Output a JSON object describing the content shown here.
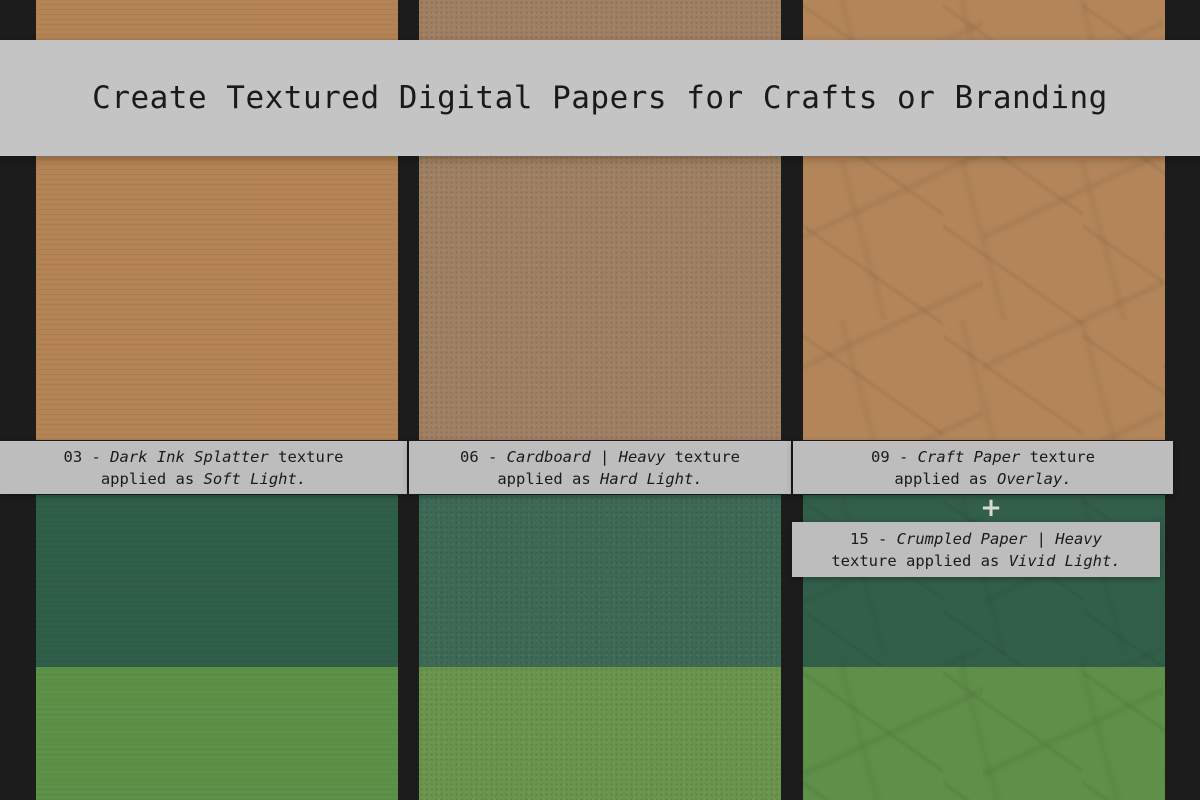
{
  "header": {
    "title": "Create Textured Digital Papers for Crafts or Branding"
  },
  "colors": {
    "background": "#1c1c1c",
    "band": "#c4c4c4",
    "caption_bg": "#bdbdbd",
    "col1_top": "#b48455",
    "col1_mid": "#2f5f48",
    "col1_bot": "#5e9148",
    "col2_top": "#9f8062",
    "col2_mid": "#3d6955",
    "col2_bot": "#6a954c",
    "col3_top": "#b38559",
    "col3_mid": "#325f4a",
    "col3_bot": "#5f8f48"
  },
  "captions": [
    {
      "number": "03 -",
      "name": "Dark Ink Splatter",
      "suffix": "texture",
      "applied": "applied as",
      "mode": "Soft Light."
    },
    {
      "number": "06 -",
      "name": "Cardboard | Heavy",
      "suffix": "texture",
      "applied": "applied as",
      "mode": "Hard Light."
    },
    {
      "number": "09 -",
      "name": "Craft Paper",
      "suffix": "texture",
      "applied": "applied as",
      "mode": "Overlay."
    },
    {
      "number": "15 -",
      "name": "Crumpled Paper | Heavy",
      "suffix": "texture applied as",
      "mode": "Vivid Light."
    }
  ],
  "plus_symbol": "+"
}
